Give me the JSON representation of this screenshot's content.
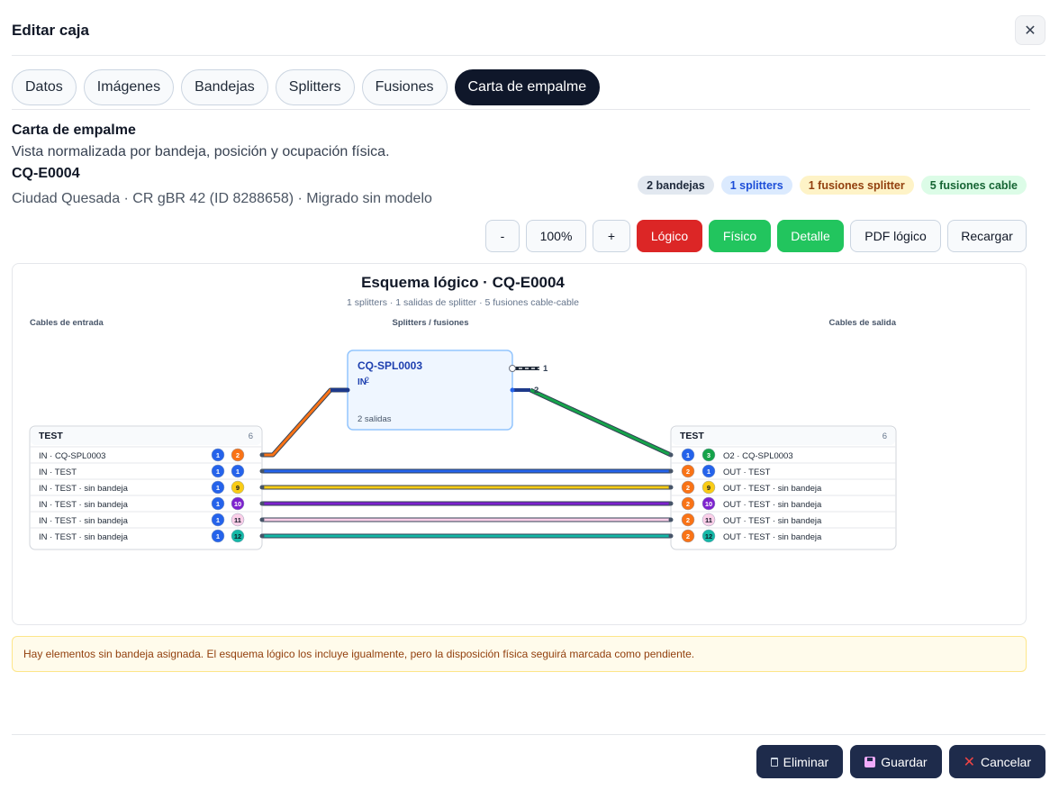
{
  "header": {
    "title": "Editar caja",
    "close_icon": "close-icon"
  },
  "tabs": [
    {
      "label": "Datos",
      "active": false
    },
    {
      "label": "Imágenes",
      "active": false
    },
    {
      "label": "Bandejas",
      "active": false
    },
    {
      "label": "Splitters",
      "active": false
    },
    {
      "label": "Fusiones",
      "active": false
    },
    {
      "label": "Carta de empalme",
      "active": true
    }
  ],
  "section": {
    "title": "Carta de empalme",
    "subtitle": "Vista normalizada por bandeja, posición y ocupación física.",
    "code": "CQ-E0004",
    "location": "Ciudad Quesada · CR gBR 42 (ID 8288658) · Migrado sin modelo"
  },
  "badges": [
    {
      "label": "2 bandejas",
      "bg": "#e2e8f0",
      "fg": "#1e293b"
    },
    {
      "label": "1 splitters",
      "bg": "#dbeafe",
      "fg": "#1d4ed8"
    },
    {
      "label": "1 fusiones splitter",
      "bg": "#fef3c7",
      "fg": "#92400e"
    },
    {
      "label": "5 fusiones cable",
      "bg": "#dcfce7",
      "fg": "#166534"
    }
  ],
  "toolbar": {
    "zoom_out": "-",
    "zoom_level": "100%",
    "zoom_in": "+",
    "logico": "Lógico",
    "fisico": "Físico",
    "detalle": "Detalle",
    "pdf": "PDF lógico",
    "reload": "Recargar"
  },
  "diagram": {
    "title": "Esquema lógico · CQ-E0004",
    "summary": "1 splitters · 1 salidas de splitter · 5 fusiones cable-cable",
    "col_in": "Cables de entrada",
    "col_mid": "Splitters / fusiones",
    "col_out": "Cables de salida",
    "splitter": {
      "name": "CQ-SPL0003",
      "in_label": "IN",
      "overlap_port": "2",
      "outputs": "2 salidas",
      "out_ports": [
        "1",
        "2"
      ]
    },
    "cable_in": {
      "name": "TEST",
      "count": "6",
      "rows": [
        {
          "label": "IN · CQ-SPL0003",
          "tube": "1",
          "tube_color": "#2563eb",
          "fiber": "2",
          "fiber_color": "#f97316",
          "fiber_fg": "#ffffff"
        },
        {
          "label": "IN · TEST",
          "tube": "1",
          "tube_color": "#2563eb",
          "fiber": "1",
          "fiber_color": "#2563eb",
          "fiber_fg": "#ffffff"
        },
        {
          "label": "IN · TEST · sin bandeja",
          "tube": "1",
          "tube_color": "#2563eb",
          "fiber": "9",
          "fiber_color": "#facc15",
          "fiber_fg": "#111827"
        },
        {
          "label": "IN · TEST · sin bandeja",
          "tube": "1",
          "tube_color": "#2563eb",
          "fiber": "10",
          "fiber_color": "#7e22ce",
          "fiber_fg": "#ffffff"
        },
        {
          "label": "IN · TEST · sin bandeja",
          "tube": "1",
          "tube_color": "#2563eb",
          "fiber": "11",
          "fiber_color": "#fbcfe8",
          "fiber_fg": "#111827"
        },
        {
          "label": "IN · TEST · sin bandeja",
          "tube": "1",
          "tube_color": "#2563eb",
          "fiber": "12",
          "fiber_color": "#14b8a6",
          "fiber_fg": "#111827"
        }
      ]
    },
    "cable_out": {
      "name": "TEST",
      "count": "6",
      "rows": [
        {
          "label": "O2 · CQ-SPL0003",
          "tube": "1",
          "tube_color": "#2563eb",
          "fiber": "3",
          "fiber_color": "#16a34a",
          "fiber_fg": "#ffffff"
        },
        {
          "label": "OUT · TEST",
          "tube": "2",
          "tube_color": "#f97316",
          "fiber": "1",
          "fiber_color": "#2563eb",
          "fiber_fg": "#ffffff"
        },
        {
          "label": "OUT · TEST · sin bandeja",
          "tube": "2",
          "tube_color": "#f97316",
          "fiber": "9",
          "fiber_color": "#facc15",
          "fiber_fg": "#111827"
        },
        {
          "label": "OUT · TEST · sin bandeja",
          "tube": "2",
          "tube_color": "#f97316",
          "fiber": "10",
          "fiber_color": "#7e22ce",
          "fiber_fg": "#ffffff"
        },
        {
          "label": "OUT · TEST · sin bandeja",
          "tube": "2",
          "tube_color": "#f97316",
          "fiber": "11",
          "fiber_color": "#fbcfe8",
          "fiber_fg": "#111827"
        },
        {
          "label": "OUT · TEST · sin bandeja",
          "tube": "2",
          "tube_color": "#f97316",
          "fiber": "12",
          "fiber_color": "#14b8a6",
          "fiber_fg": "#111827"
        }
      ]
    },
    "links": [
      {
        "from": "in-0",
        "to": "splitter-in",
        "color": "#f97316"
      },
      {
        "from": "splitter-out-2",
        "to": "out-0",
        "color": "#16a34a"
      },
      {
        "from": "in-1",
        "to": "out-1",
        "color": "#2563eb"
      },
      {
        "from": "in-2",
        "to": "out-2",
        "color": "#facc15"
      },
      {
        "from": "in-3",
        "to": "out-3",
        "color": "#7e22ce"
      },
      {
        "from": "in-4",
        "to": "out-4",
        "color": "#fbcfe8"
      },
      {
        "from": "in-5",
        "to": "out-5",
        "color": "#14b8a6"
      }
    ]
  },
  "warning": "Hay elementos sin bandeja asignada. El esquema lógico los incluye igualmente, pero la disposición física seguirá marcada como pendiente.",
  "footer": {
    "delete": "Eliminar",
    "save": "Guardar",
    "cancel": "Cancelar"
  }
}
